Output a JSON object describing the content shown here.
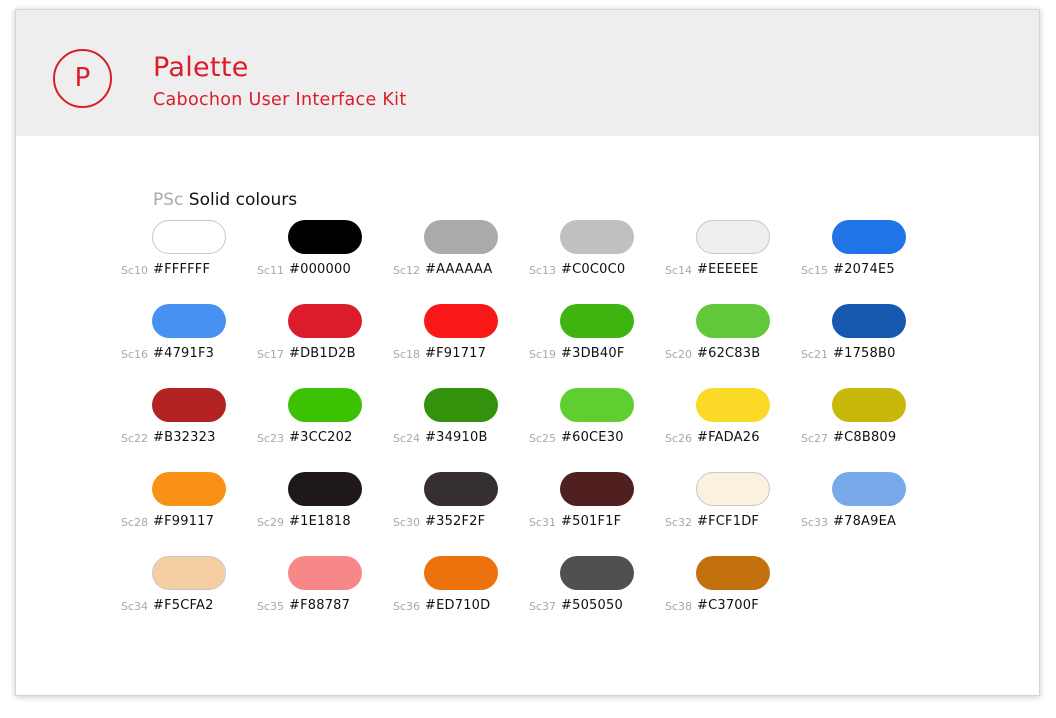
{
  "header": {
    "logo_letter": "P",
    "title": "Palette",
    "subtitle": "Cabochon User Interface Kit"
  },
  "section": {
    "code": "PSc",
    "title": "Solid colours"
  },
  "swatches": [
    {
      "code": "Sc10",
      "hex": "#FFFFFF",
      "color": "#FFFFFF",
      "light": true
    },
    {
      "code": "Sc11",
      "hex": "#000000",
      "color": "#000000",
      "light": false
    },
    {
      "code": "Sc12",
      "hex": "#AAAAAA",
      "color": "#AAAAAA",
      "light": false
    },
    {
      "code": "Sc13",
      "hex": "#C0C0C0",
      "color": "#C0C0C0",
      "light": false
    },
    {
      "code": "Sc14",
      "hex": "#EEEEEE",
      "color": "#EEEEEE",
      "light": true
    },
    {
      "code": "Sc15",
      "hex": "#2074E5",
      "color": "#2074E5",
      "light": false
    },
    {
      "code": "Sc16",
      "hex": "#4791F3",
      "color": "#4791F3",
      "light": false
    },
    {
      "code": "Sc17",
      "hex": "#DB1D2B",
      "color": "#DB1D2B",
      "light": false
    },
    {
      "code": "Sc18",
      "hex": "#F91717",
      "color": "#F91717",
      "light": false
    },
    {
      "code": "Sc19",
      "hex": "#3DB40F",
      "color": "#3DB40F",
      "light": false
    },
    {
      "code": "Sc20",
      "hex": "#62C83B",
      "color": "#62C83B",
      "light": false
    },
    {
      "code": "Sc21",
      "hex": "#1758B0",
      "color": "#1758B0",
      "light": false
    },
    {
      "code": "Sc22",
      "hex": "#B32323",
      "color": "#B32323",
      "light": false
    },
    {
      "code": "Sc23",
      "hex": "#3CC202",
      "color": "#3CC202",
      "light": false
    },
    {
      "code": "Sc24",
      "hex": "#34910B",
      "color": "#34910B",
      "light": false
    },
    {
      "code": "Sc25",
      "hex": "#60CE30",
      "color": "#60CE30",
      "light": false
    },
    {
      "code": "Sc26",
      "hex": "#FADA26",
      "color": "#FADA26",
      "light": false
    },
    {
      "code": "Sc27",
      "hex": "#C8B809",
      "color": "#C8B809",
      "light": false
    },
    {
      "code": "Sc28",
      "hex": "#F99117",
      "color": "#F99117",
      "light": false
    },
    {
      "code": "Sc29",
      "hex": "#1E1818",
      "color": "#1E1818",
      "light": false
    },
    {
      "code": "Sc30",
      "hex": "#352F2F",
      "color": "#352F2F",
      "light": false
    },
    {
      "code": "Sc31",
      "hex": "#501F1F",
      "color": "#501F1F",
      "light": false
    },
    {
      "code": "Sc32",
      "hex": "#FCF1DF",
      "color": "#FCF1DF",
      "light": true
    },
    {
      "code": "Sc33",
      "hex": "#78A9EA",
      "color": "#78A9EA",
      "light": false
    },
    {
      "code": "Sc34",
      "hex": "#F5CFA2",
      "color": "#F5CFA2",
      "light": true
    },
    {
      "code": "Sc35",
      "hex": "#F88787",
      "color": "#F88787",
      "light": false
    },
    {
      "code": "Sc36",
      "hex": "#ED710D",
      "color": "#ED710D",
      "light": false
    },
    {
      "code": "Sc37",
      "hex": "#505050",
      "color": "#505050",
      "light": false
    },
    {
      "code": "Sc38",
      "hex": "#C3700F",
      "color": "#C3700F",
      "light": false
    }
  ],
  "colors": {
    "accent": "#DB1D2B",
    "header_bg": "#EEEEEE",
    "muted": "#AAAAAA"
  }
}
